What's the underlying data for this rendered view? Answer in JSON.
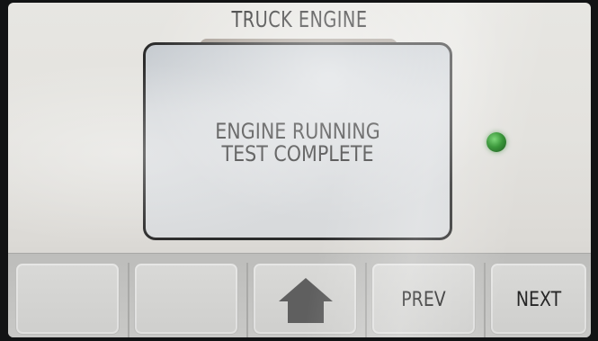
{
  "header": {
    "title": "TRUCK ENGINE"
  },
  "message": {
    "line1": "ENGINE RUNNING",
    "line2": "TEST COMPLETE"
  },
  "status_indicator": {
    "color": "#2a8f2a",
    "state": "green"
  },
  "toolbar": {
    "buttons": [
      {
        "label": ""
      },
      {
        "label": ""
      },
      {
        "label": "",
        "icon": "home-icon"
      },
      {
        "label": "PREV"
      },
      {
        "label": "NEXT"
      }
    ]
  },
  "colors": {
    "screen_bg": "#e3e2de",
    "text": "#2e2e2e",
    "led": "#2a8f2a"
  }
}
